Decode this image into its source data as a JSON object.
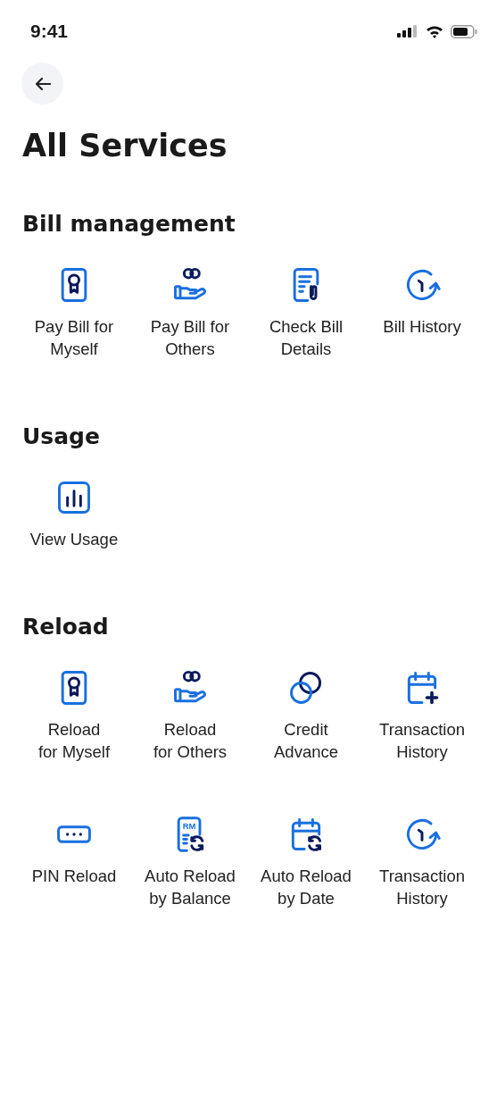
{
  "status_bar": {
    "time": "9:41"
  },
  "title": "All Services",
  "sections": [
    {
      "heading": "Bill management",
      "items": [
        {
          "label": "Pay Bill for\nMyself",
          "kind": "certificate"
        },
        {
          "label": "Pay Bill for\nOthers",
          "kind": "hand-coins"
        },
        {
          "label": "Check Bill\nDetails",
          "kind": "bill-clip"
        },
        {
          "label": "Bill History",
          "kind": "history"
        }
      ]
    },
    {
      "heading": "Usage",
      "items": [
        {
          "label": "View Usage",
          "kind": "chart"
        }
      ]
    },
    {
      "heading": "Reload",
      "items": [
        {
          "label": "Reload\nfor Myself",
          "kind": "certificate"
        },
        {
          "label": "Reload\nfor Others",
          "kind": "hand-coins"
        },
        {
          "label": "Credit\nAdvance",
          "kind": "circles"
        },
        {
          "label": "Transaction\nHistory",
          "kind": "calendar-plus"
        },
        {
          "label": "PIN Reload",
          "kind": "pin"
        },
        {
          "label": "Auto Reload\nby Balance",
          "kind": "rm-refresh",
          "icon_text": "RM"
        },
        {
          "label": "Auto Reload\nby Date",
          "kind": "calendar-refresh"
        },
        {
          "label": "Transaction\nHistory",
          "kind": "history"
        }
      ]
    }
  ]
}
